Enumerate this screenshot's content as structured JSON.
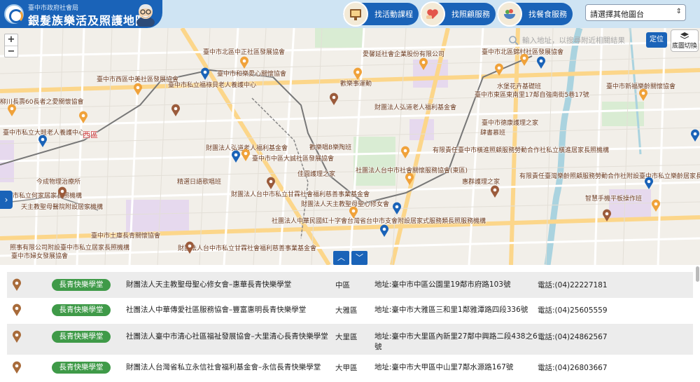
{
  "header": {
    "org": "臺中市政府社會局",
    "title": "銀髮族樂活及照護地圖",
    "nav": [
      {
        "label": "找活動課程",
        "icon": "activity-board-icon"
      },
      {
        "label": "找照顧服務",
        "icon": "care-heart-icon"
      },
      {
        "label": "找餐食服務",
        "icon": "meal-bowl-icon"
      }
    ],
    "layer_select": "請選擇其他圖台"
  },
  "map": {
    "search_placeholder": "輸入地址，以搜尋附近相關結果",
    "locate_label": "定位",
    "basemap_label_1": "底圖切換",
    "zoom_in": "+",
    "zoom_out": "−",
    "side_toggle": "›",
    "collapse_up": "︿",
    "collapse_down": "﹀",
    "labels": [
      "臺中市北區中正社區發展協會",
      "愛馨延社會企業股份有限公司",
      "臺中市北區錦村社區發展協會",
      "臺中市西區中美社區發展協會",
      "臺中市和樂愛心關懷協會",
      "臺中市私立福祿貝老人養護中心",
      "歡樂事運動",
      "臺中市東區東南里17鄰自強南街5巷17號",
      "臺中市新福樂齡關懷協會",
      "柳川長壽60長者之愛關懷協會",
      "財團法人弘道老人福利基金會",
      "水堡花卉基礎班",
      "臺中市私立大畦老人養護中心",
      "西區",
      "有限責任臺中市橫進照顧服務勞動合作社私立橫進居家長照機構",
      "臺中市德康護理之家",
      "肆書慕班",
      "財團法人弘道老人福利基金會",
      "歡樂唱B樂陶班",
      "有限責任臺灣樂齡照顧服務勞動合作社附設臺中市私立樂齡居家長照機構",
      "今成物理治療所",
      "臺中市中區大誠社區發展協會",
      "佳圓護理之家",
      "社團法人台中市社會關懷服務協會(東區)",
      "臺中市私立何家居家長照機構",
      "精選日語歌唱班",
      "惠群護理之家",
      "財團法人台中市私立甘霖社會福利慈善事業基金會",
      "智慧手機平板操作班",
      "財團法人天主教聖母聖心修女會",
      "天主教聖母醫院附設居家機構",
      "社團法人中華民國紅十字會台灣省台中市支會附設居家式服務類長照服務機構",
      "臺中市土庫長青關懷協會",
      "財團法人台中市私立甘霖社會福利慈善事業基金會",
      "臺中市婦女發展協會",
      "照事有限公司附設臺中市私立居家長照機構"
    ]
  },
  "list": {
    "rows": [
      {
        "badge": "長青快樂學堂",
        "org": "財團法人天主教聖母聖心修女會–惠華長青快樂學堂",
        "district": "中區",
        "address": "地址:臺中市中區公園里19鄰市府路103號",
        "phone": "電話:(04)22227181"
      },
      {
        "badge": "長青快樂學堂",
        "org": "社團法人中華傳愛社區服務協會–豐富惠明長青快樂學堂",
        "district": "大雅區",
        "address": "地址:臺中市大雅區三和里1鄰雅潭路四段336號",
        "phone": "電話:(04)25605559"
      },
      {
        "badge": "長青快樂學堂",
        "org": "社團法人臺中市清心社區福祉發展協會–大里清心長青快樂學堂",
        "district": "大里區",
        "address": "地址:臺中市大里區內新里27鄰中興路二段438之6號",
        "phone": "電話:(04)24862567"
      },
      {
        "badge": "長青快樂學堂",
        "org": "財團法人台灣省私立永信社會福利基金會–永信長青快樂學堂",
        "district": "大甲區",
        "address": "地址:臺中市大甲區中山里7鄰水源路167號",
        "phone": "電話:(04)26803667"
      }
    ]
  },
  "colors": {
    "brand": "#1a63b8",
    "badge": "#3f9a48",
    "pin_orange": "#f0a23a",
    "pin_blue": "#1a63b8"
  }
}
